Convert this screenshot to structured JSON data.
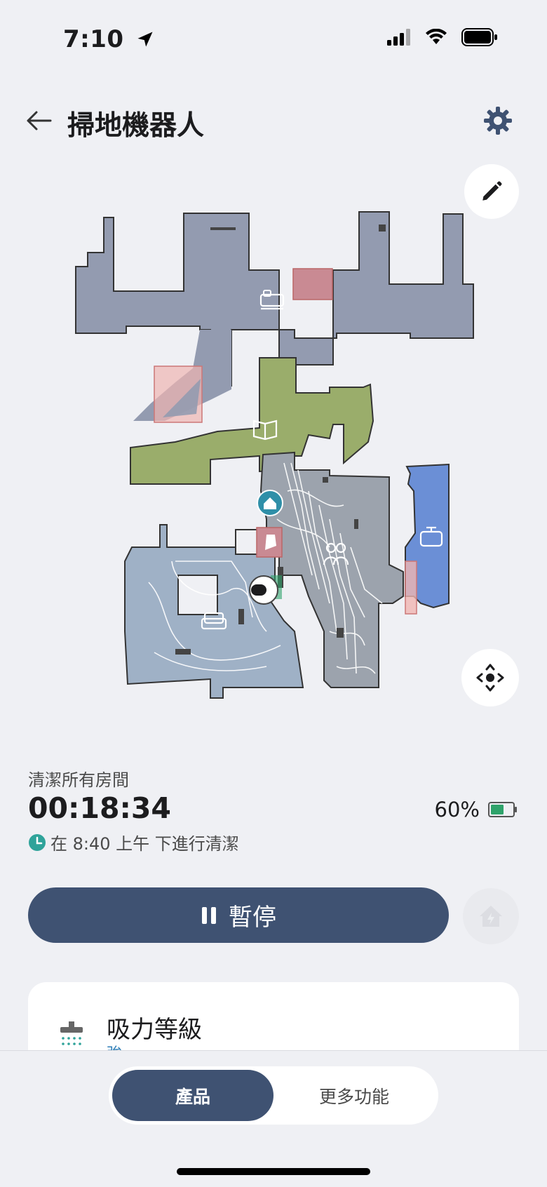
{
  "status_bar": {
    "time": "7:10",
    "icons": [
      "location-arrow-icon",
      "signal-icon",
      "wifi-icon",
      "battery-icon"
    ]
  },
  "header": {
    "title": "掃地機器人",
    "back_icon": "back-arrow-icon",
    "settings_icon": "gear-icon"
  },
  "map": {
    "edit_icon": "pencil-icon",
    "locate_icon": "move-robot-icon",
    "room_icons": [
      "bed-icon",
      "book-icon",
      "home-dock-icon",
      "people-icon",
      "pot-icon",
      "sofa-icon"
    ],
    "room_colors": {
      "gray_blue": "#939bb0",
      "green": "#9aad6b",
      "slate": "#9ca3ad",
      "blue": "#6b8fd6",
      "light_blue": "#9fb1c6",
      "no_go_zone": "#f0b5b2"
    }
  },
  "cleaning": {
    "task_label": "清潔所有房間",
    "elapsed": "00:18:34",
    "schedule_text": "在 8:40 上午 下進行清潔",
    "battery_percent": "60%",
    "battery_level": 0.6
  },
  "actions": {
    "pause_label": "暫停",
    "dock_icon": "home-charge-icon"
  },
  "suction_card": {
    "title": "吸力等級",
    "value": "強",
    "icon": "suction-icon"
  },
  "bottom_nav": {
    "tabs": [
      "產品",
      "更多功能"
    ],
    "active_index": 0
  },
  "colors": {
    "primary": "#3f5272",
    "background": "#eff0f4",
    "battery_green": "#2fa36b"
  }
}
